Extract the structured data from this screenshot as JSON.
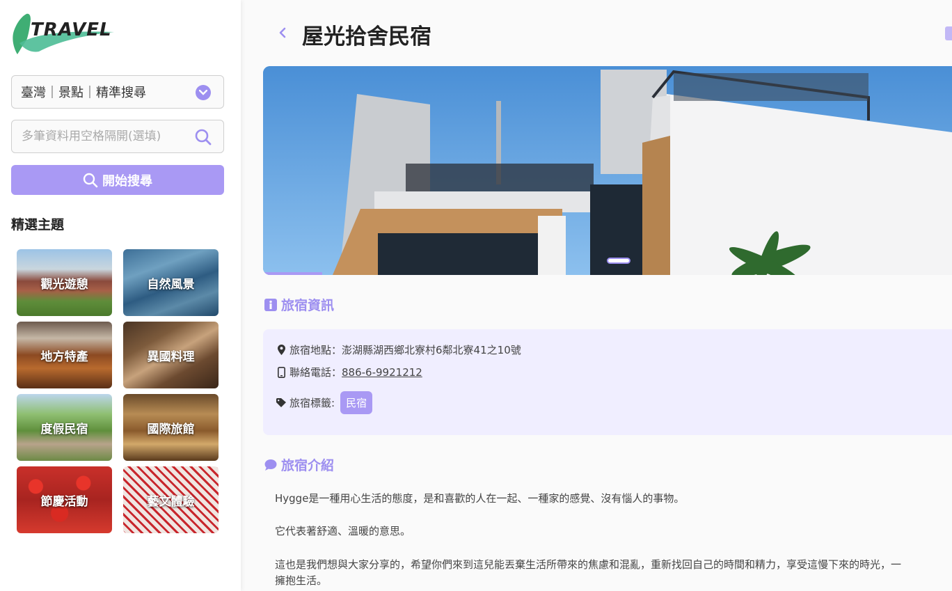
{
  "logo": {
    "text": "TRAVEL"
  },
  "sidebar": {
    "select_value": "臺灣｜景點｜精準搜尋",
    "search_placeholder": "多筆資料用空格隔開(選填)",
    "search_button": "開始搜尋",
    "section_title": "精選主題",
    "themes": [
      {
        "label": "觀光遊憩"
      },
      {
        "label": "自然風景"
      },
      {
        "label": "地方特產"
      },
      {
        "label": "異國料理"
      },
      {
        "label": "度假民宿"
      },
      {
        "label": "國際旅館"
      },
      {
        "label": "節慶活動"
      },
      {
        "label": "藝文體驗"
      }
    ]
  },
  "main": {
    "title": "屋光拾舍民宿",
    "info_heading": "旅宿資訊",
    "address_label": "旅宿地點：",
    "address_value": "澎湖縣湖西鄉北寮村6鄰北寮41之10號",
    "phone_label": "聯絡電話：",
    "phone_value": "886-6-9921212",
    "tags_label": "旅宿標籤:",
    "tags": [
      "民宿"
    ],
    "intro_heading": "旅宿介紹",
    "intro_paragraphs": [
      "Hygge是一種用心生活的態度，是和喜歡的人在一起、一種家的感覺、沒有惱人的事物。",
      "它代表著舒適、溫暖的意思。",
      "這也是我們想與大家分享的，希望你們來到這兒能丟棄生活所帶來的焦慮和混亂，重新找回自己的時間和精力，享受這慢下來的時光，一",
      "擁抱生活。"
    ]
  },
  "colors": {
    "accent": "#a999f4",
    "accent_dark": "#9d8ff0",
    "info_bg": "#f0eeff"
  }
}
